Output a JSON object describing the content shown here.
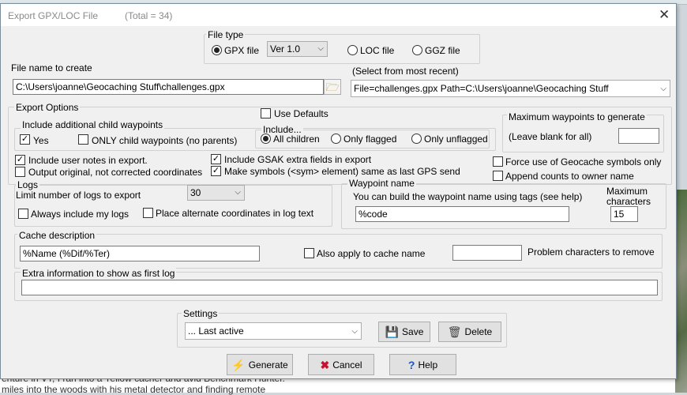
{
  "title": "Export GPX/LOC File",
  "total": "(Total = 34)",
  "file_type": {
    "label": "File type",
    "gpx": "GPX file",
    "version": "Ver 1.0",
    "loc": "LOC file",
    "ggz": "GGZ file"
  },
  "file_name": {
    "label": "File name to create",
    "value": "C:\\Users\\joanne\\Geocaching Stuff\\challenges.gpx",
    "recent_label": "(Select from most recent)",
    "recent_value": "File=challenges.gpx Path=C:\\Users\\joanne\\Geocaching Stuff"
  },
  "export_options": {
    "label": "Export Options",
    "use_defaults": "Use Defaults",
    "child_waypoints": {
      "label": "Include additional child waypoints",
      "yes": "Yes",
      "only_child": "ONLY child waypoints (no parents)"
    },
    "include": {
      "label": "Include...",
      "all_children": "All children",
      "only_flagged": "Only flagged",
      "only_unflagged": "Only unflagged"
    },
    "max_waypoints": {
      "label": "Maximum waypoints to generate",
      "hint": "(Leave blank for all)",
      "value": ""
    },
    "user_notes": "Include user notes in export.",
    "original_coords": "Output original, not corrected coordinates",
    "gsak_fields": "Include GSAK extra fields in export",
    "make_symbols": "Make symbols (<sym> element) same as last GPS send",
    "force_symbols": "Force use of Geocache symbols only",
    "append_counts": "Append counts to owner name"
  },
  "logs": {
    "label": "Logs",
    "limit_label": "Limit number of logs to export",
    "limit_value": "30",
    "always_mine": "Always include my logs",
    "alt_coords": "Place alternate coordinates in log text"
  },
  "waypoint_name": {
    "label": "Waypoint name",
    "hint": "You can build the waypoint name using tags (see help)",
    "value": "%code",
    "max_label_1": "Maximum",
    "max_label_2": "characters",
    "max_value": "15"
  },
  "cache_description": {
    "label": "Cache description",
    "value": "%Name (%Dif/%Ter)",
    "apply_cache_name": "Also apply to cache name",
    "problem_value": "",
    "problem_label": "Problem characters to remove"
  },
  "extra_info": {
    "label": "Extra information to show as first log",
    "value": ""
  },
  "settings": {
    "label": "Settings",
    "value": "... Last active",
    "save": "Save",
    "delete": "Delete"
  },
  "buttons": {
    "generate": "Generate",
    "cancel": "Cancel",
    "help": "Help"
  },
  "background": {
    "line1": "enture in VT, I ran into a Yellow cacher and avid Benchmark Hunter.",
    "line2": "miles into the woods with his metal detector and finding remote"
  }
}
